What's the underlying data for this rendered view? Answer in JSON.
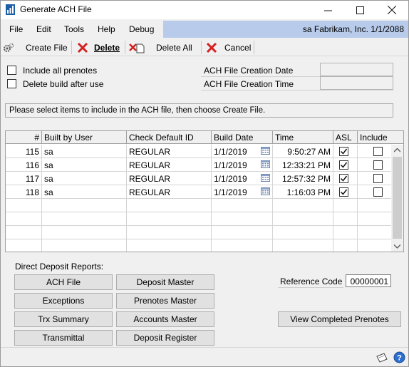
{
  "window": {
    "title": "Generate ACH File"
  },
  "menu": {
    "items": [
      "File",
      "Edit",
      "Tools",
      "Help",
      "Debug"
    ],
    "company": "sa  Fabrikam, Inc.  1/1/2088"
  },
  "toolbar": {
    "create_file": "Create File",
    "delete": "Delete",
    "delete_all": "Delete All",
    "cancel": "Cancel"
  },
  "options": {
    "include_all_prenotes": "Include all prenotes",
    "delete_build_after_use": "Delete build after use",
    "creation_date_label": "ACH File Creation Date",
    "creation_time_label": "ACH File Creation Time"
  },
  "info": {
    "message": "Please select items to include in the ACH file, then choose Create File."
  },
  "grid": {
    "headers": {
      "num": "#",
      "built_by": "Built by User",
      "check_default_id": "Check Default ID",
      "build_date": "Build Date",
      "time": "Time",
      "asl": "ASL",
      "include": "Include"
    },
    "rows": [
      {
        "num": "115",
        "user": "sa",
        "check_id": "REGULAR",
        "date": "1/1/2019",
        "time": "9:50:27 AM",
        "asl": true,
        "include": false
      },
      {
        "num": "116",
        "user": "sa",
        "check_id": "REGULAR",
        "date": "1/1/2019",
        "time": "12:33:21 PM",
        "asl": true,
        "include": false
      },
      {
        "num": "117",
        "user": "sa",
        "check_id": "REGULAR",
        "date": "1/1/2019",
        "time": "12:57:32 PM",
        "asl": true,
        "include": false
      },
      {
        "num": "118",
        "user": "sa",
        "check_id": "REGULAR",
        "date": "1/1/2019",
        "time": "1:16:03 PM",
        "asl": true,
        "include": false
      }
    ]
  },
  "reports": {
    "label": "Direct Deposit Reports:",
    "ach_file": "ACH File",
    "deposit_master": "Deposit Master",
    "exceptions": "Exceptions",
    "prenotes_master": "Prenotes Master",
    "trx_summary": "Trx Summary",
    "accounts_master": "Accounts Master",
    "transmittal": "Transmittal",
    "deposit_register": "Deposit Register"
  },
  "reference": {
    "label": "Reference Code",
    "value": "00000001"
  },
  "view_completed_prenotes": "View Completed Prenotes",
  "colors": {
    "company_bar": "#b8cbea",
    "accent_red": "#d42020"
  }
}
